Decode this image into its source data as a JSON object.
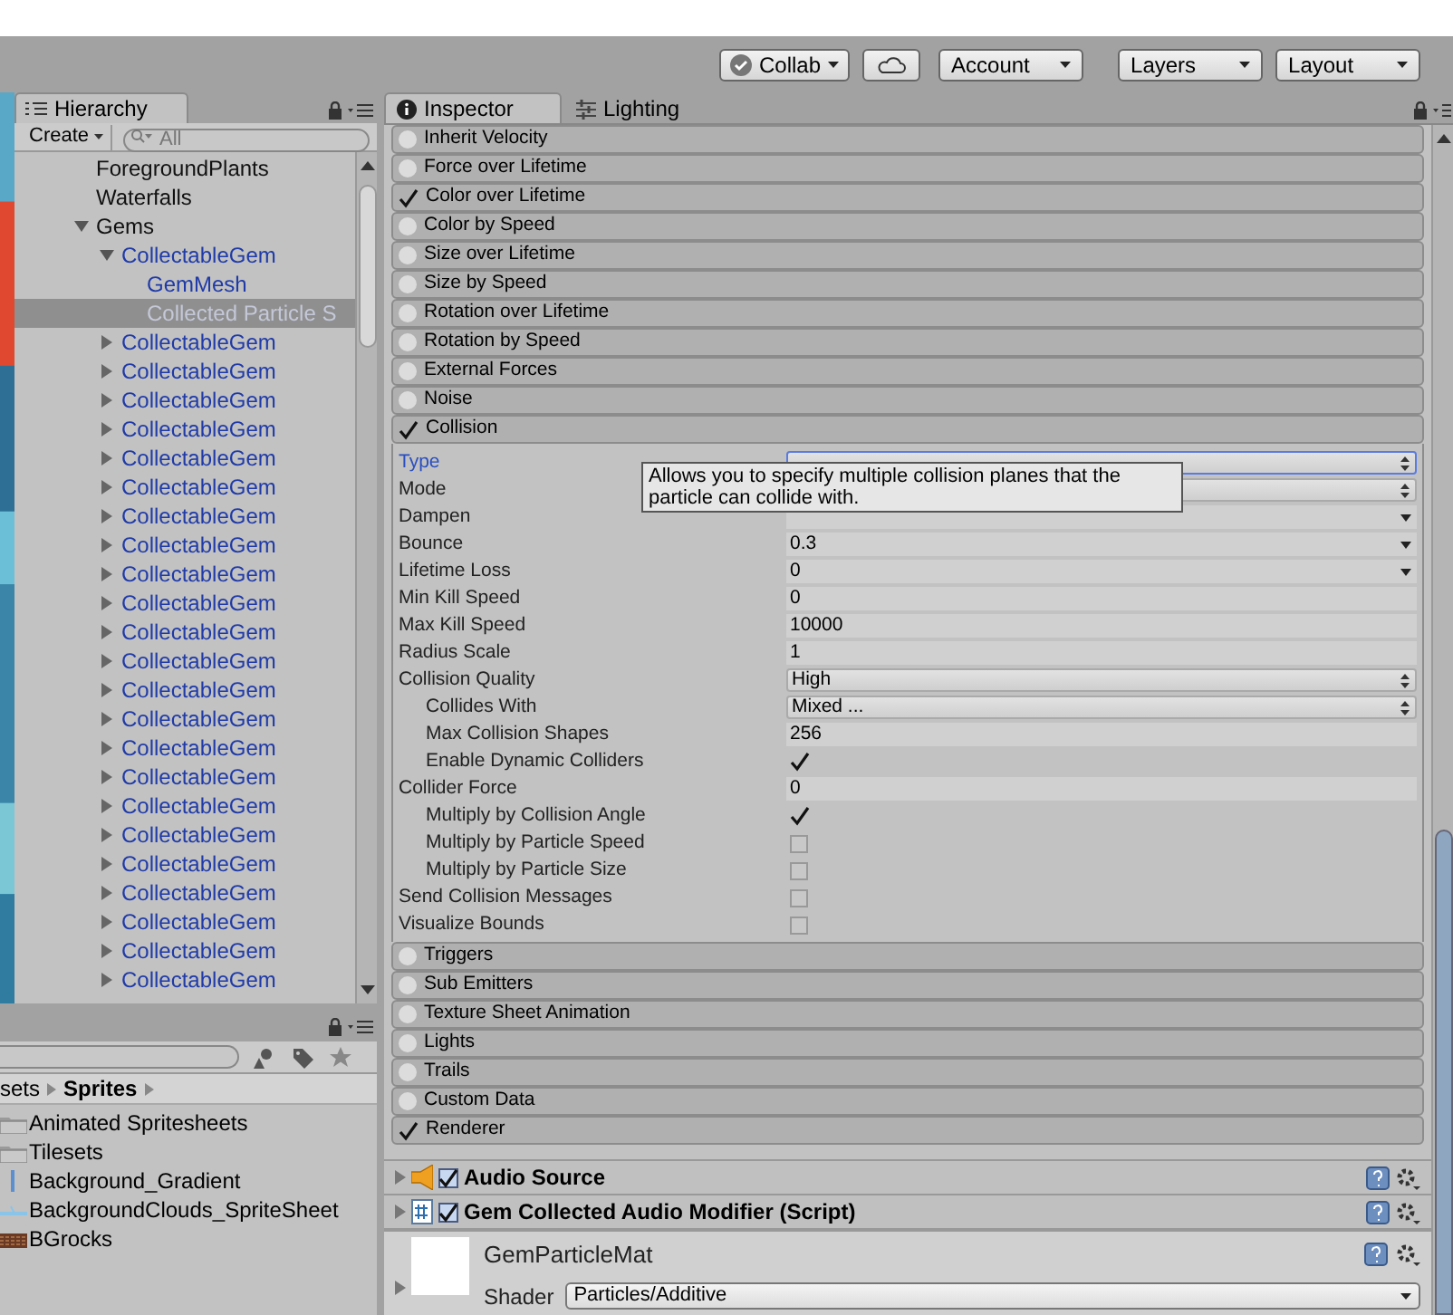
{
  "toolbar": {
    "collab": "Collab",
    "menus": [
      "Account",
      "Layers",
      "Layout"
    ]
  },
  "hierarchy": {
    "tab": "Hierarchy",
    "create": "Create",
    "search_placeholder": "All",
    "items": [
      {
        "label": "ForegroundPlants",
        "kind": "object",
        "selected": false
      },
      {
        "label": "Waterfalls",
        "kind": "object",
        "selected": false
      },
      {
        "label": "Gems",
        "kind": "object",
        "selected": false,
        "expanded": true,
        "children": [
          {
            "label": "CollectableGem",
            "kind": "prefab",
            "selected": false,
            "expanded": true,
            "children": [
              {
                "label": "GemMesh",
                "kind": "prefab",
                "selected": false
              },
              {
                "label": "Collected Particle S",
                "kind": "prefab",
                "selected": true
              }
            ]
          },
          {
            "label": "CollectableGem",
            "kind": "prefab",
            "selected": false,
            "expanded": false
          },
          {
            "label": "CollectableGem",
            "kind": "prefab",
            "selected": false,
            "expanded": false
          },
          {
            "label": "CollectableGem",
            "kind": "prefab",
            "selected": false,
            "expanded": false
          },
          {
            "label": "CollectableGem",
            "kind": "prefab",
            "selected": false,
            "expanded": false
          },
          {
            "label": "CollectableGem",
            "kind": "prefab",
            "selected": false,
            "expanded": false
          },
          {
            "label": "CollectableGem",
            "kind": "prefab",
            "selected": false,
            "expanded": false
          },
          {
            "label": "CollectableGem",
            "kind": "prefab",
            "selected": false,
            "expanded": false
          },
          {
            "label": "CollectableGem",
            "kind": "prefab",
            "selected": false,
            "expanded": false
          },
          {
            "label": "CollectableGem",
            "kind": "prefab",
            "selected": false,
            "expanded": false
          },
          {
            "label": "CollectableGem",
            "kind": "prefab",
            "selected": false,
            "expanded": false
          },
          {
            "label": "CollectableGem",
            "kind": "prefab",
            "selected": false,
            "expanded": false
          },
          {
            "label": "CollectableGem",
            "kind": "prefab",
            "selected": false,
            "expanded": false
          },
          {
            "label": "CollectableGem",
            "kind": "prefab",
            "selected": false,
            "expanded": false
          },
          {
            "label": "CollectableGem",
            "kind": "prefab",
            "selected": false,
            "expanded": false
          },
          {
            "label": "CollectableGem",
            "kind": "prefab",
            "selected": false,
            "expanded": false
          },
          {
            "label": "CollectableGem",
            "kind": "prefab",
            "selected": false,
            "expanded": false
          },
          {
            "label": "CollectableGem",
            "kind": "prefab",
            "selected": false,
            "expanded": false
          },
          {
            "label": "CollectableGem",
            "kind": "prefab",
            "selected": false,
            "expanded": false
          },
          {
            "label": "CollectableGem",
            "kind": "prefab",
            "selected": false,
            "expanded": false
          },
          {
            "label": "CollectableGem",
            "kind": "prefab",
            "selected": false,
            "expanded": false
          },
          {
            "label": "CollectableGem",
            "kind": "prefab",
            "selected": false,
            "expanded": false
          },
          {
            "label": "CollectableGem",
            "kind": "prefab",
            "selected": false,
            "expanded": false
          },
          {
            "label": "CollectableGem",
            "kind": "prefab",
            "selected": false,
            "expanded": false
          }
        ]
      }
    ]
  },
  "project": {
    "breadcrumb": [
      "sets",
      "Sprites"
    ],
    "items": [
      {
        "label": "Animated Spritesheets",
        "kind": "folder"
      },
      {
        "label": "Tilesets",
        "kind": "folder"
      },
      {
        "label": "Background_Gradient",
        "kind": "gradient"
      },
      {
        "label": "BackgroundClouds_SpriteSheet",
        "kind": "clouds"
      },
      {
        "label": "BGrocks",
        "kind": "rocks"
      }
    ]
  },
  "inspector": {
    "tabs": [
      {
        "label": "Inspector",
        "kind": "info",
        "selected": true
      },
      {
        "label": "Lighting",
        "kind": "sliders",
        "selected": false
      }
    ],
    "modules": [
      {
        "label": "Inherit Velocity",
        "enabled": false
      },
      {
        "label": "Force over Lifetime",
        "enabled": false
      },
      {
        "label": "Color over Lifetime",
        "enabled": true
      },
      {
        "label": "Color by Speed",
        "enabled": false
      },
      {
        "label": "Size over Lifetime",
        "enabled": false
      },
      {
        "label": "Size by Speed",
        "enabled": false
      },
      {
        "label": "Rotation over Lifetime",
        "enabled": false
      },
      {
        "label": "Rotation by Speed",
        "enabled": false
      },
      {
        "label": "External Forces",
        "enabled": false
      },
      {
        "label": "Noise",
        "enabled": false
      },
      {
        "label": "Collision",
        "enabled": true,
        "fields": [
          {
            "label": "Type",
            "kind": "select",
            "focused": true
          },
          {
            "label": "Mode",
            "kind": "select",
            "focused": false
          },
          {
            "label": "Dampen",
            "kind": "curve",
            "focused": false
          },
          {
            "label": "Bounce",
            "kind": "curve",
            "value": "0.3",
            "focused": false
          },
          {
            "label": "Lifetime Loss",
            "kind": "curve",
            "value": "0",
            "focused": false
          },
          {
            "label": "Min Kill Speed",
            "kind": "number",
            "value": "0",
            "focused": false
          },
          {
            "label": "Max Kill Speed",
            "kind": "number",
            "value": "10000",
            "focused": false
          },
          {
            "label": "Radius Scale",
            "kind": "number",
            "value": "1",
            "focused": false
          },
          {
            "label": "Collision Quality",
            "kind": "select",
            "value": "High",
            "focused": false,
            "children": [
              {
                "label": "Collides With",
                "kind": "select",
                "value": "Mixed ...",
                "focused": false
              },
              {
                "label": "Max Collision Shapes",
                "kind": "number",
                "value": "256",
                "focused": false
              },
              {
                "label": "Enable Dynamic Colliders",
                "kind": "checkbox",
                "checked": true,
                "focused": false
              }
            ]
          },
          {
            "label": "Collider Force",
            "kind": "number",
            "value": "0",
            "focused": false,
            "children": [
              {
                "label": "Multiply by Collision Angle",
                "kind": "checkbox",
                "checked": true,
                "focused": false
              },
              {
                "label": "Multiply by Particle Speed",
                "kind": "checkbox",
                "checked": false,
                "focused": false
              },
              {
                "label": "Multiply by Particle Size",
                "kind": "checkbox",
                "checked": false,
                "focused": false
              }
            ]
          },
          {
            "label": "Send Collision Messages",
            "kind": "checkbox",
            "checked": false,
            "focused": false
          },
          {
            "label": "Visualize Bounds",
            "kind": "checkbox",
            "checked": false,
            "focused": false
          }
        ]
      },
      {
        "label": "Triggers",
        "enabled": false
      },
      {
        "label": "Sub Emitters",
        "enabled": false
      },
      {
        "label": "Texture Sheet Animation",
        "enabled": false
      },
      {
        "label": "Lights",
        "enabled": false
      },
      {
        "label": "Trails",
        "enabled": false
      },
      {
        "label": "Custom Data",
        "enabled": false
      },
      {
        "label": "Renderer",
        "enabled": true
      }
    ],
    "tooltip": "Allows you to specify multiple collision planes that the particle can collide with.",
    "components": [
      {
        "kind": "audio",
        "label": "Audio Source",
        "enabled": true
      },
      {
        "kind": "script",
        "label": "Gem Collected Audio Modifier (Script)",
        "enabled": true
      }
    ],
    "material": {
      "name": "GemParticleMat",
      "shader_label": "Shader",
      "shader": "Particles/Additive"
    }
  }
}
